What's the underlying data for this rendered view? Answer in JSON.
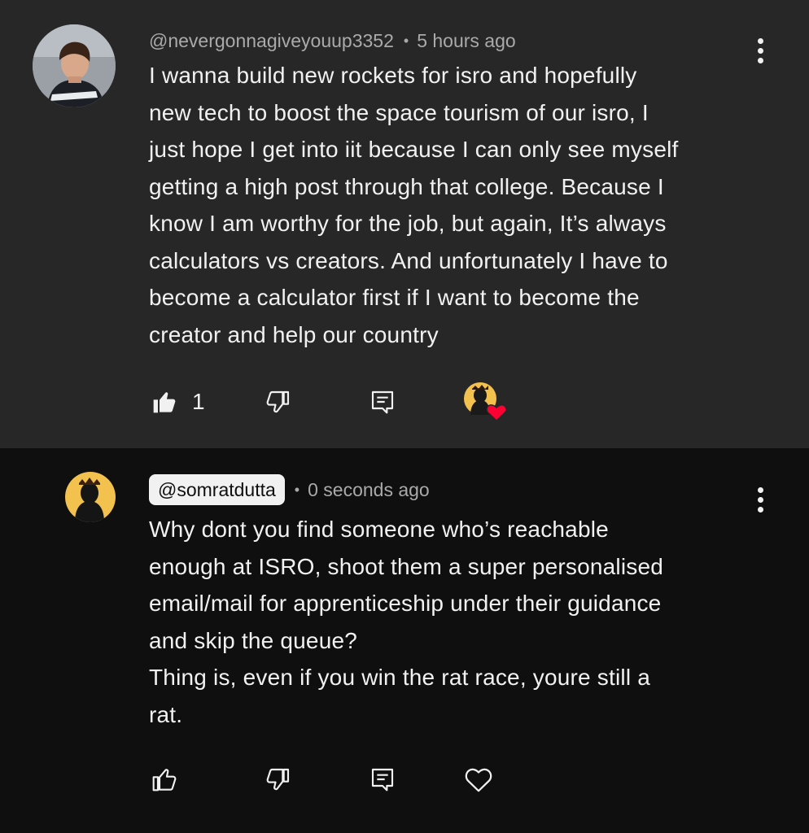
{
  "comments": [
    {
      "handle": "@nevergonnagiveyouup3352",
      "time": "5 hours ago",
      "separator": "•",
      "lines": [
        "I wanna build new rockets for isro and hopefully",
        "new tech to boost the space tourism of our isro, I",
        "just hope I get into iit because I can only see myself",
        "getting a high post through that college. Because I",
        "know I am worthy for the job, but again, It’s always",
        "calculators vs creators. And unfortunately I have to",
        "become a calculator first if I want to become the",
        "creator and help our country"
      ],
      "like_count": "1",
      "icons": {
        "like": "thumbs-up-filled-icon",
        "dislike": "thumbs-down-icon",
        "reply": "reply-icon",
        "creator_heart": "creator-heart-icon",
        "menu": "more-vert-icon"
      }
    },
    {
      "handle": "@somratdutta",
      "time": "0 seconds ago",
      "separator": "•",
      "lines": [
        "Why dont you find someone who’s reachable",
        "enough at ISRO, shoot them a super personalised",
        "email/mail for apprenticeship under their guidance",
        "and skip the queue?",
        "Thing is, even if you win the rat race, youre still a",
        "rat."
      ],
      "icons": {
        "like": "thumbs-up-icon",
        "dislike": "thumbs-down-icon",
        "reply": "reply-icon",
        "heart": "heart-outline-icon",
        "menu": "more-vert-icon"
      }
    }
  ],
  "colors": {
    "panel1_bg": "#272727",
    "panel2_bg": "#0f0f0f",
    "text": "#f1f1f1",
    "meta": "#aaaaaa",
    "heart": "#ff0033"
  }
}
